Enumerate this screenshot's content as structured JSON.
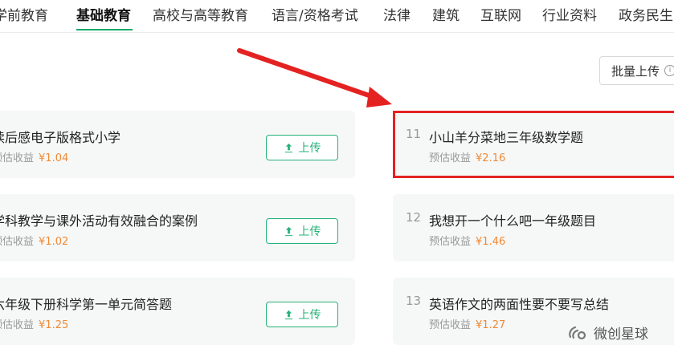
{
  "tabs": [
    {
      "label": "学前教育"
    },
    {
      "label": "基础教育"
    },
    {
      "label": "高校与高等教育"
    },
    {
      "label": "语言/资格考试"
    },
    {
      "label": "法律"
    },
    {
      "label": "建筑"
    },
    {
      "label": "互联网"
    },
    {
      "label": "行业资料"
    },
    {
      "label": "政务民生"
    }
  ],
  "active_tab": "基础教育",
  "batch_upload": {
    "label": "批量上传"
  },
  "earn_label": "预估收益",
  "currency": "¥",
  "upload_label": "上传",
  "left_items": [
    {
      "title": "读后感电子版格式小学",
      "amount": "1.04"
    },
    {
      "title": "学科教学与课外活动有效融合的案例",
      "amount": "1.02"
    },
    {
      "title": "六年级下册科学第一单元简答题",
      "amount": "1.25"
    }
  ],
  "right_items": [
    {
      "num": "11",
      "title": "小山羊分菜地三年级数学题",
      "amount": "2.16"
    },
    {
      "num": "12",
      "title": "我想开一个什么吧一年级题目",
      "amount": "1.46"
    },
    {
      "num": "13",
      "title": "英语作文的两面性要不要写总结",
      "amount": "1.27"
    }
  ],
  "watermark": {
    "text": "微创星球"
  },
  "colors": {
    "accent": "#1aa86b",
    "earn": "#f08a35",
    "highlight": "#e42222",
    "arrow": "#e42222"
  }
}
